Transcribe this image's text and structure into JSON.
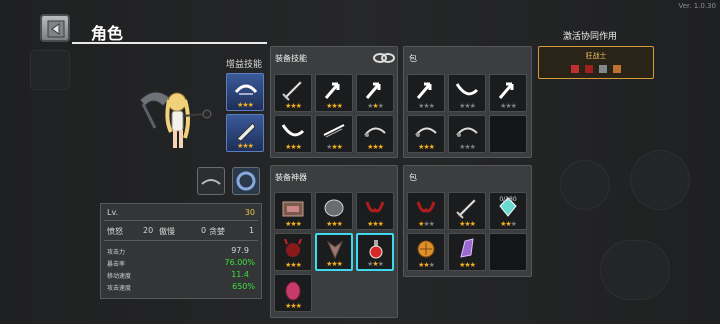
{
  "version": "Ver. 1.0.30",
  "header": {
    "title": "角色",
    "back_icon": "back-arrow-icon"
  },
  "gain_skills": {
    "label": "增益技能",
    "slots": [
      {
        "icon": "whirl-icon",
        "stars": [
          1,
          1,
          1
        ]
      },
      {
        "icon": "blade-icon",
        "stars": [
          1,
          1,
          1
        ]
      }
    ]
  },
  "equip_skills": {
    "label": "装备技能",
    "slots": [
      {
        "icon": "dagger-icon",
        "stars": [
          1,
          1,
          1
        ]
      },
      {
        "icon": "arrow-icon",
        "stars": [
          1,
          1,
          1
        ]
      },
      {
        "icon": "arrow-icon",
        "stars": [
          0,
          1,
          0
        ]
      },
      {
        "icon": "scimitar-icon",
        "stars": [
          1,
          1,
          1
        ]
      },
      {
        "icon": "slash-icon",
        "stars": [
          0,
          1,
          1
        ]
      },
      {
        "icon": "whip-icon",
        "stars": [
          1,
          1,
          1
        ]
      }
    ]
  },
  "bag_skills": {
    "label": "包",
    "slots": [
      {
        "icon": "arrow-icon",
        "stars": [
          0,
          0,
          0
        ]
      },
      {
        "icon": "scimitar-icon",
        "stars": [
          0,
          0,
          0
        ]
      },
      {
        "icon": "arrow-icon",
        "stars": [
          0,
          0,
          0
        ]
      },
      {
        "icon": "whip-icon",
        "stars": [
          1,
          1,
          1
        ]
      },
      {
        "icon": "whip-icon",
        "stars": [
          0,
          0,
          0
        ]
      },
      {
        "icon": "",
        "stars": []
      }
    ]
  },
  "artifacts": {
    "label": "装备神器",
    "slots": [
      {
        "icon": "chest-icon",
        "stars": [
          1,
          1,
          1
        ]
      },
      {
        "icon": "stone-icon",
        "stars": [
          1,
          1,
          1
        ]
      },
      {
        "icon": "horns-icon",
        "stars": [
          1,
          1,
          1
        ]
      },
      {
        "icon": "demon-icon",
        "stars": [
          1,
          1,
          1
        ]
      },
      {
        "icon": "wolf-icon",
        "stars": [
          1,
          1,
          1
        ]
      },
      {
        "icon": "potion-icon",
        "stars": [
          0,
          1,
          0
        ]
      },
      {
        "icon": "egg-icon",
        "stars": [
          1,
          1,
          1
        ]
      }
    ]
  },
  "bag_artifacts": {
    "label": "包",
    "slots": [
      {
        "icon": "horns-icon",
        "stars": [
          1,
          0,
          0
        ],
        "count": ""
      },
      {
        "icon": "dagger-icon",
        "stars": [
          1,
          1,
          1
        ],
        "count": ""
      },
      {
        "icon": "gem-icon",
        "stars": [
          1,
          1,
          0
        ],
        "count": "0/180"
      },
      {
        "icon": "coin-icon",
        "stars": [
          1,
          1,
          0
        ],
        "count": ""
      },
      {
        "icon": "crystal-icon",
        "stars": [
          1,
          1,
          1
        ],
        "count": ""
      },
      {
        "icon": "",
        "stars": [],
        "count": ""
      }
    ]
  },
  "stats": {
    "level_label": "Lv.",
    "level": "30",
    "row1": [
      {
        "label": "愤怒",
        "value": "20"
      },
      {
        "label": "傲慢",
        "value": "0"
      },
      {
        "label": "贪婪",
        "value": "1"
      }
    ],
    "details": [
      {
        "label": "攻击力",
        "value": "97.9",
        "color": "#e6e6e6"
      },
      {
        "label": "暴击率",
        "value": "76.00%",
        "color": "#3ae23a"
      },
      {
        "label": "移动速度",
        "value": "11.4",
        "color": "#3ae23a"
      },
      {
        "label": "攻击速度",
        "value": "650%",
        "color": "#3ae23a"
      }
    ]
  },
  "synergy": {
    "label": "激活协同作用",
    "name": "狂战士"
  },
  "colors": {
    "star_on": "#f2b01e",
    "star_off": "#7d7f81",
    "highlight": "#3fd8ee",
    "synergy_border": "#d49a3a"
  }
}
